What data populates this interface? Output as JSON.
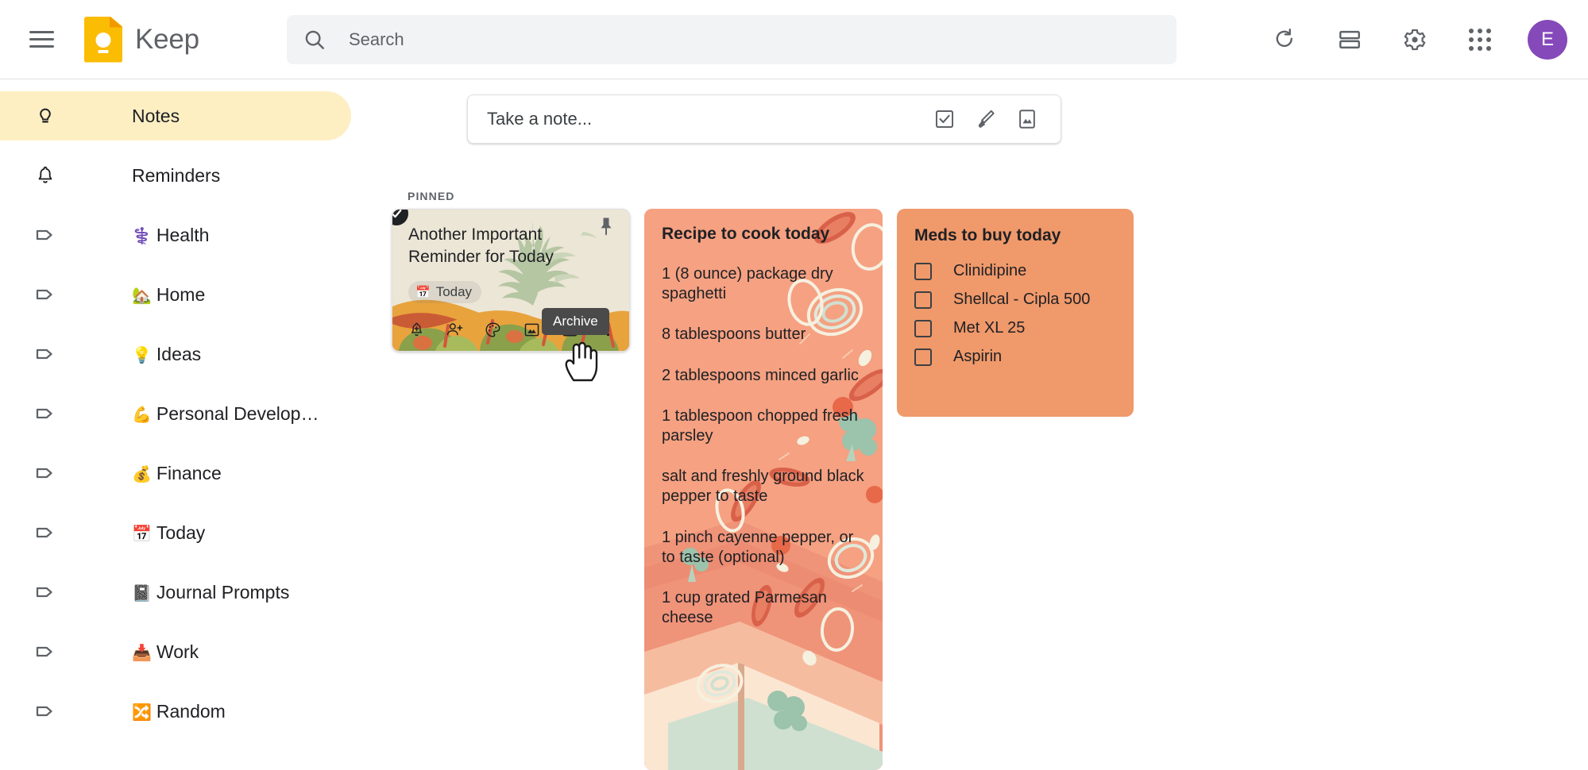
{
  "app": {
    "name": "Keep",
    "accent_yellow": "#fbbc04",
    "active_nav_bg": "#feefc3",
    "avatar_color": "#8549ba",
    "avatar_initial": "E"
  },
  "topbar": {
    "menu_label": "Main menu",
    "refresh_label": "Refresh",
    "list_view_label": "List view",
    "settings_label": "Settings",
    "apps_label": "Google apps",
    "account_label": "Google Account"
  },
  "search": {
    "placeholder": "Search",
    "value": ""
  },
  "sidebar": {
    "items": [
      {
        "emoji": "",
        "label": "Notes",
        "icon": "bulb-icon",
        "active": true
      },
      {
        "emoji": "",
        "label": "Reminders",
        "icon": "bell-icon",
        "active": false
      },
      {
        "emoji": "⚕️",
        "label": "Health",
        "icon": "label-icon",
        "active": false
      },
      {
        "emoji": "🏡",
        "label": "Home",
        "icon": "label-icon",
        "active": false
      },
      {
        "emoji": "💡",
        "label": "Ideas",
        "icon": "label-icon",
        "active": false
      },
      {
        "emoji": "💪",
        "label": "Personal Development/H…",
        "icon": "label-icon",
        "active": false
      },
      {
        "emoji": "💰",
        "label": "Finance",
        "icon": "label-icon",
        "active": false
      },
      {
        "emoji": "📅",
        "label": "Today",
        "icon": "label-icon",
        "active": false
      },
      {
        "emoji": "📓",
        "label": "Journal Prompts",
        "icon": "label-icon",
        "active": false
      },
      {
        "emoji": "📥",
        "label": "Work",
        "icon": "label-icon",
        "active": false
      },
      {
        "emoji": "🔀",
        "label": "Random",
        "icon": "label-icon",
        "active": false
      }
    ]
  },
  "take_note": {
    "placeholder": "Take a note...",
    "checklist_label": "New list",
    "draw_label": "New note with drawing",
    "image_label": "New note with image"
  },
  "notes_section": {
    "pinned_header": "PINNED"
  },
  "notes": {
    "pinned": {
      "title": "Another Important Reminder for Today",
      "reminder_chip": "Today",
      "reminder_emoji": "📅",
      "selected": true,
      "pinned": true,
      "background": "vegetables-illustration",
      "toolbar": [
        {
          "name": "remind-me-icon",
          "label": "Remind me"
        },
        {
          "name": "collaborator-icon",
          "label": "Collaborator"
        },
        {
          "name": "palette-icon",
          "label": "Background options"
        },
        {
          "name": "image-icon",
          "label": "Add image"
        },
        {
          "name": "archive-icon",
          "label": "Archive"
        },
        {
          "name": "more-options-icon",
          "label": "More"
        }
      ]
    },
    "recipe": {
      "title": "Recipe to cook today",
      "background_color": "#f5a182",
      "items": [
        "1 (8 ounce) package dry spaghetti",
        "8 tablespoons butter",
        "2 tablespoons minced garlic",
        "1 tablespoon chopped fresh parsley",
        "salt and freshly ground black pepper to taste",
        "1 pinch cayenne pepper, or to taste (optional)",
        "1 cup grated Parmesan cheese"
      ]
    },
    "meds": {
      "title": "Meds to buy today",
      "background_color": "#f0996b",
      "items": [
        {
          "text": "Clinidipine",
          "checked": false
        },
        {
          "text": "Shellcal - Cipla 500",
          "checked": false
        },
        {
          "text": "Met XL 25",
          "checked": false
        },
        {
          "text": "Aspirin",
          "checked": false
        }
      ]
    }
  },
  "tooltip": {
    "text": "Archive"
  }
}
